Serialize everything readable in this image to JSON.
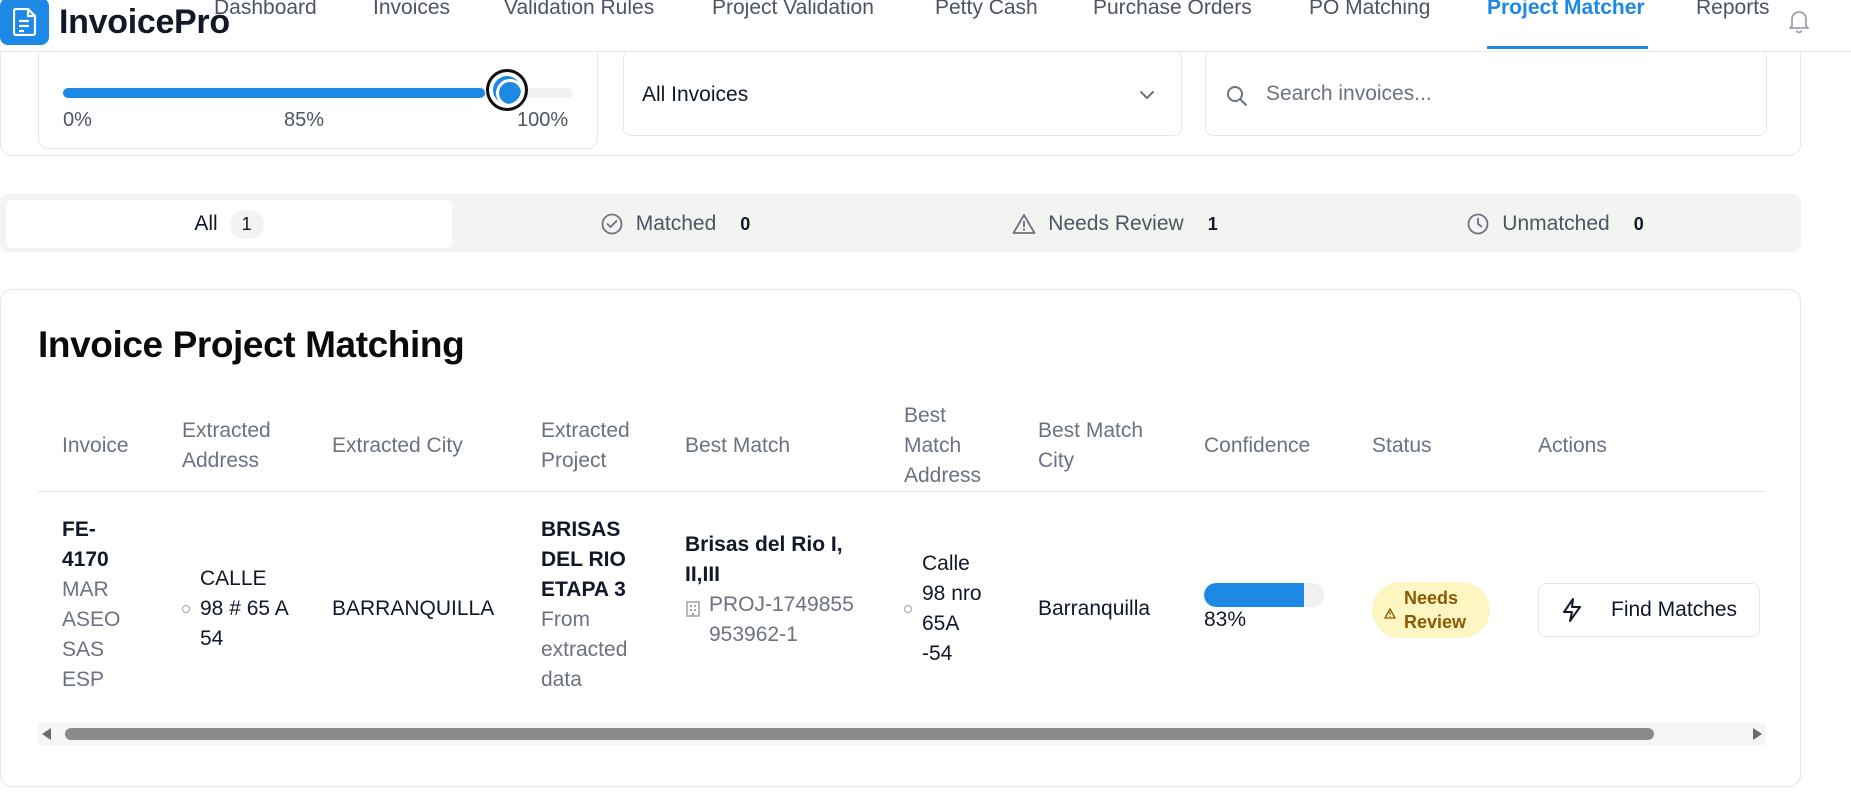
{
  "app": {
    "brand": "InvoicePro",
    "logo_icon": "document-icon"
  },
  "nav": {
    "items": [
      {
        "label": "Dashboard",
        "active": false
      },
      {
        "label": "Invoices",
        "active": false
      },
      {
        "label": "Validation Rules",
        "active": false
      },
      {
        "label": "Project Validation",
        "active": false
      },
      {
        "label": "Petty Cash",
        "active": false
      },
      {
        "label": "Purchase Orders",
        "active": false
      },
      {
        "label": "PO Matching",
        "active": false
      },
      {
        "label": "Project Matcher",
        "active": true
      },
      {
        "label": "Reports",
        "active": false
      }
    ],
    "notification_icon": "bell-icon",
    "accent_color": "#1e88e5"
  },
  "filters": {
    "slider": {
      "value_percent": 85,
      "min_label": "0%",
      "mid_label": "85%",
      "max_label": "100%"
    },
    "invoice_filter": {
      "selected": "All Invoices"
    },
    "search": {
      "placeholder": "Search invoices...",
      "value": ""
    }
  },
  "tabs": [
    {
      "label": "All",
      "count": "1",
      "icon": "",
      "active": true
    },
    {
      "label": "Matched",
      "count": "0",
      "icon": "check-circle-icon",
      "active": false
    },
    {
      "label": "Needs Review",
      "count": "1",
      "icon": "warning-triangle-icon",
      "active": false
    },
    {
      "label": "Unmatched",
      "count": "0",
      "icon": "clock-icon",
      "active": false
    }
  ],
  "table": {
    "title": "Invoice Project Matching",
    "columns": [
      "Invoice",
      "Extracted Address",
      "Extracted City",
      "Extracted Project",
      "Best Match",
      "Best Match Address",
      "Best Match City",
      "Confidence",
      "Status",
      "Actions"
    ],
    "rows": [
      {
        "invoice_number": "FE-4170",
        "vendor": "MAR ASEO SAS ESP",
        "extracted_address": "CALLE 98 # 65 A 54",
        "extracted_city": "BARRANQUILLA",
        "extracted_project": "BRISAS DEL RIO ETAPA 3",
        "extracted_project_note": "From extracted data",
        "best_match": "Brisas del Rio I, II,III",
        "best_match_code": "PROJ-1749855953962-1",
        "best_match_address": "Calle 98 nro 65A -54",
        "best_match_city": "Barranquilla",
        "confidence_value": 0.83,
        "confidence_label": "83%",
        "status": "Needs Review",
        "status_colors": {
          "bg": "#fdf6c3",
          "text": "#8a5a00"
        },
        "action_label": "Find Matches",
        "action_icon": "lightning-icon"
      }
    ]
  }
}
